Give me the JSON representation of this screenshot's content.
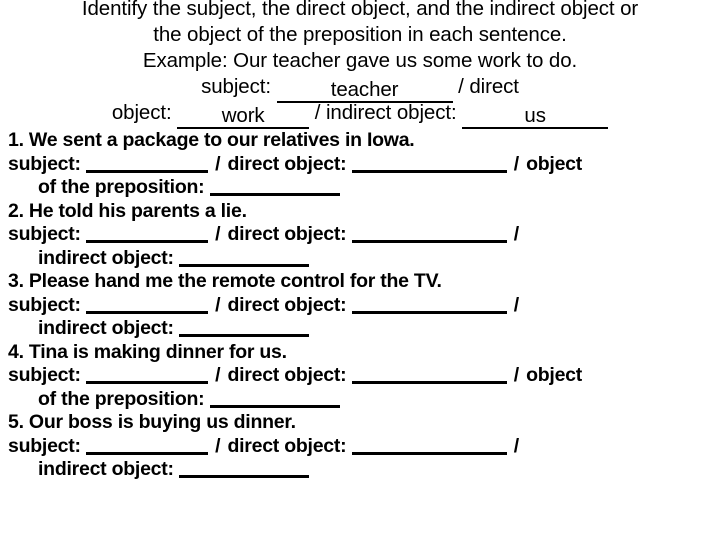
{
  "header": {
    "lines": [
      "Identify the subject, the direct object, and the indirect object or",
      "the object of the preposition in each sentence.",
      "Example: Our teacher gave us some work to do."
    ]
  },
  "example": {
    "subject_label": "subject:",
    "subject_answer": "teacher",
    "direct_object_label_part1": "/ direct",
    "direct_object_label_part2": "object:",
    "direct_object_answer": "work",
    "indirect_object_label": "/ indirect object:",
    "indirect_object_answer": "us"
  },
  "labels": {
    "subject": "subject:",
    "slash": "/",
    "direct_object": "direct object:",
    "object_of_preposition_part1": "object",
    "object_of_preposition_part2": "of the preposition:",
    "indirect_object": "indirect object:"
  },
  "items": [
    {
      "number": "1.",
      "sentence": "We sent a package to our relatives in Iowa.",
      "prompt": "1. We sent a package to our relatives in Iowa.",
      "third_blank_type": "object_of_preposition"
    },
    {
      "number": "2.",
      "sentence": "He told his parents a lie.",
      "prompt": "2. He told his parents a lie.",
      "third_blank_type": "indirect_object"
    },
    {
      "number": "3.",
      "sentence": "Please hand me the remote control for the TV.",
      "prompt": "3. Please hand me the remote control for the TV.",
      "third_blank_type": "indirect_object"
    },
    {
      "number": "4.",
      "sentence": "Tina is making dinner for us.",
      "prompt": "4. Tina is making dinner for us.",
      "third_blank_type": "object_of_preposition"
    },
    {
      "number": "5.",
      "sentence": "Our boss is buying us dinner.",
      "prompt": "5. Our boss is buying us dinner.",
      "third_blank_type": "indirect_object"
    }
  ],
  "colors": {
    "text": "#000000",
    "background": "#ffffff",
    "rule": "#000000"
  }
}
